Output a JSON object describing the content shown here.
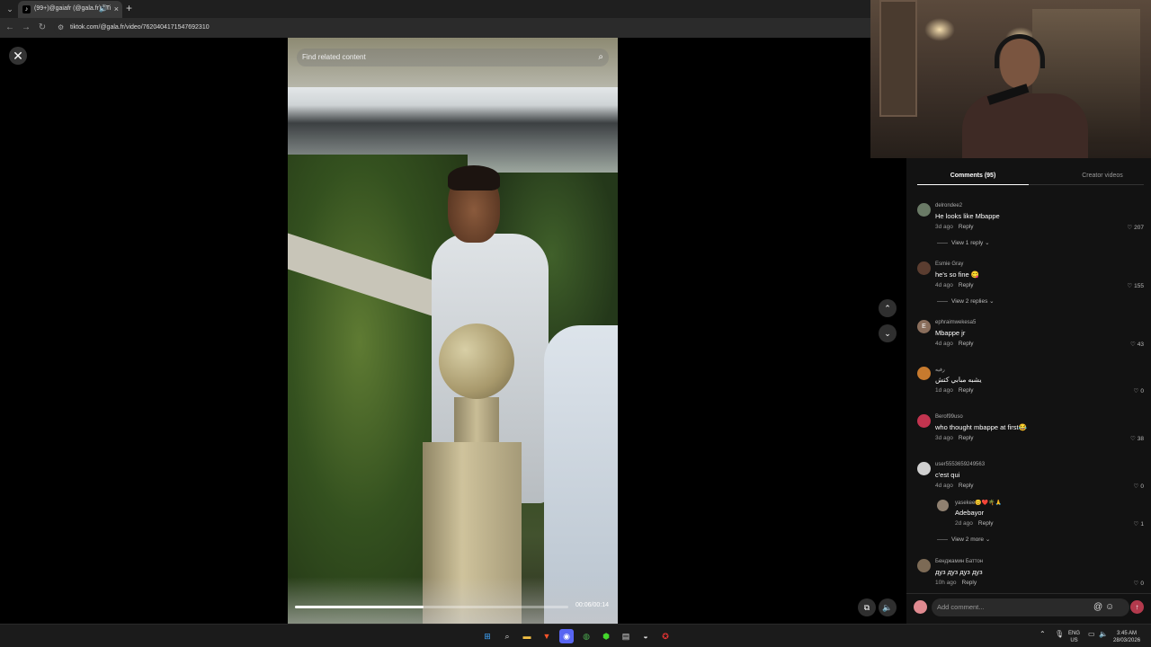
{
  "browser": {
    "tab_title": "(99+)@gaiafr (@gala.fr) | Ti",
    "tab_favicon": "tiktok-icon",
    "url": "tiktok.com/@gala.fr/video/7620404171547692310"
  },
  "video": {
    "search_placeholder": "Find related content",
    "time": "00:06/00:14",
    "progress_fraction": 0.47
  },
  "comments_tabs": {
    "active": "Comments (95)",
    "other": "Creator videos"
  },
  "comments": [
    {
      "user": "delrondee2",
      "text": "He looks like Mbappe",
      "time": "3d ago",
      "reply": "Reply",
      "likes": "207",
      "more": "View 1 reply",
      "avatar_color": "#6a7a66"
    },
    {
      "user": "Esmie Gray",
      "text": "he's so fine 😋",
      "time": "4d ago",
      "reply": "Reply",
      "likes": "155",
      "more": "View 2 replies",
      "avatar_color": "#5b3d30"
    },
    {
      "user": "ephraimwekesa5",
      "text": "Mbappe jr",
      "time": "4d ago",
      "reply": "Reply",
      "likes": "43",
      "avatar_letter": "E",
      "avatar_color": "#8a6e5c"
    },
    {
      "user": "رفيه",
      "text": "يشبه مبابي كتش",
      "time": "1d ago",
      "reply": "Reply",
      "likes": "0",
      "avatar_color": "#c77a2e"
    },
    {
      "user": "Berof99uso",
      "text": "who thought mbappe at first😂",
      "time": "3d ago",
      "reply": "Reply",
      "likes": "38",
      "avatar_color": "#c2344f"
    },
    {
      "user": "user5553659249563",
      "text": "c'est qui",
      "time": "4d ago",
      "reply": "Reply",
      "likes": "0",
      "avatar_color": "#cfcfcf"
    },
    {
      "user": "yasekee😊❤️🌴🙏",
      "text": "Adebayor",
      "time": "2d ago",
      "reply": "Reply",
      "likes": "1",
      "more": "View 2 more",
      "avatar_color": "#8f8070"
    },
    {
      "user": "Бенджамин Баттон",
      "text": "дуз дуз дуз дуз",
      "time": "10h ago",
      "reply": "Reply",
      "likes": "0",
      "avatar_color": "#7c6a55"
    }
  ],
  "add_comment": {
    "placeholder": "Add comment..."
  },
  "tray": {
    "lang_top": "ENG",
    "lang_bottom": "US",
    "time": "3:45 AM",
    "date": "28/03/2026"
  },
  "icons": {
    "close": "close-icon",
    "search": "search-icon",
    "heart": "heart-icon",
    "up": "chevron-up-icon",
    "down": "chevron-down-icon"
  }
}
